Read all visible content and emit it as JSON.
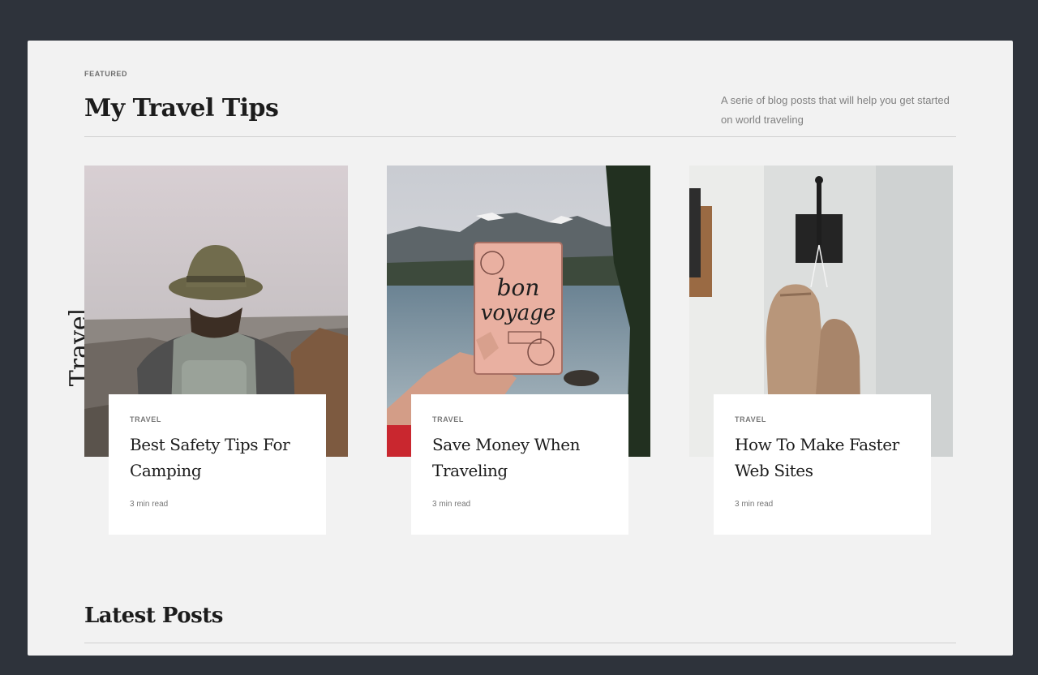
{
  "section": {
    "label": "FEATURED",
    "title": "My Travel Tips",
    "description": "A serie of blog posts that will help you get started on world traveling",
    "side_label": "Travel"
  },
  "cards": [
    {
      "category": "TRAVEL",
      "title": "Best Safety Tips For Camping",
      "meta": "3 min read",
      "image_icon": "hiker-photo"
    },
    {
      "category": "TRAVEL",
      "title": "Save Money When Traveling",
      "meta": "3 min read",
      "image_icon": "passport-photo",
      "image_text": "bon voyage"
    },
    {
      "category": "TRAVEL",
      "title": "How To Make Faster Web Sites",
      "meta": "3 min read",
      "image_icon": "boxing-gloves-photo"
    }
  ],
  "latest": {
    "title": "Latest Posts"
  },
  "colors": {
    "background": "#2e333b",
    "panel": "#f2f2f2",
    "card": "#ffffff",
    "text": "#1c1c1c",
    "muted": "#777777"
  }
}
